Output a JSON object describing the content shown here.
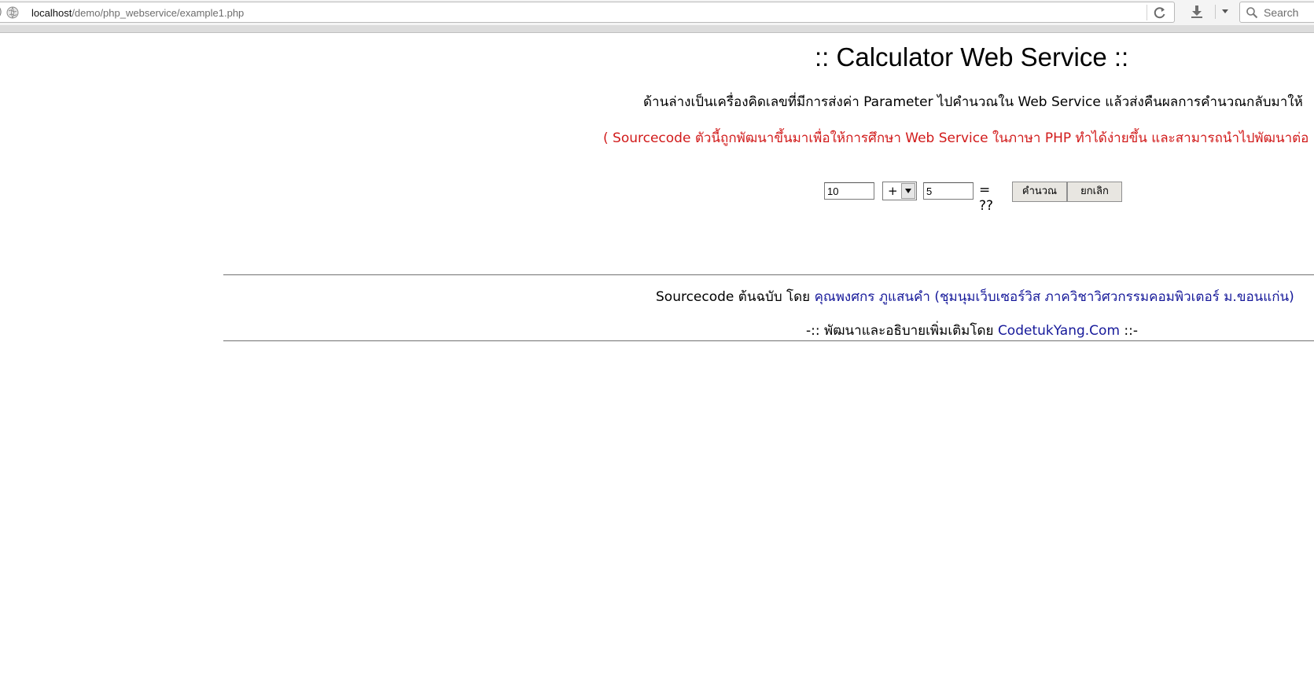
{
  "browser": {
    "url_host": "localhost",
    "url_path": "/demo/php_webservice/example1.php",
    "search_placeholder": "Search"
  },
  "page": {
    "title": ":: Calculator Web Service ::",
    "description": "ด้านล่างเป็นเครื่องคิดเลขที่มีการส่งค่า Parameter ไปคำนวณใน Web Service แล้วส่งคืนผลการคำนวณกลับมาให้",
    "note": "( Sourcecode ตัวนี้ถูกพัฒนาขึ้นมาเพื่อให้การศึกษา Web Service ในภาษา PHP ทำได้ง่ายขึ้น และสามารถนำไปพัฒนาต่อ",
    "calculator": {
      "num1": "10",
      "operator": "+",
      "num2": "5",
      "result_text": "= ??",
      "calc_button": "คำนวณ",
      "cancel_button": "ยกเลิก"
    },
    "credit": {
      "prefix": "Sourcecode ต้นฉบับ โดย",
      "author_link": "คุณพงศกร ภูแสนคำ (ชุมนุมเว็บเซอร์วิส ภาควิชาวิศวกรรมคอมพิวเตอร์ ม.ขอนแก่น)"
    },
    "developer": {
      "prefix": "-:: พัฒนาและอธิบายเพิ่มเติมโดย",
      "site_link": "CodetukYang.Com",
      "suffix": "::-"
    }
  },
  "colors": {
    "note_red": "#d11a1a",
    "link_blue": "#16199a"
  }
}
